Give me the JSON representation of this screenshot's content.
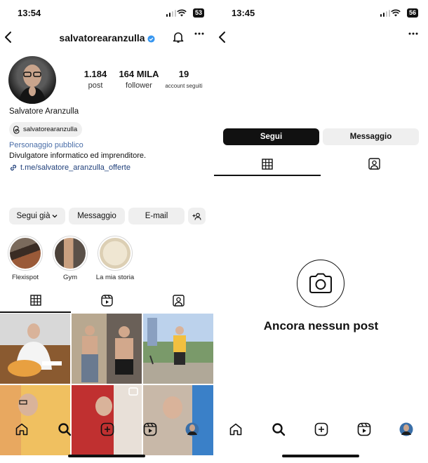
{
  "left": {
    "status": {
      "time": "13:54",
      "battery": "53"
    },
    "username": "salvatorearanzulla",
    "stats": [
      {
        "value": "1.184",
        "label": "post"
      },
      {
        "value": "164 MILA",
        "label": "follower"
      },
      {
        "value": "19",
        "label": "account seguiti"
      }
    ],
    "full_name": "Salvatore Aranzulla",
    "threads_handle": "salvatorearanzulla",
    "category": "Personaggio pubblico",
    "bio": "Divulgatore informatico ed imprenditore.",
    "link": "t.me/salvatore_aranzulla_offerte",
    "buttons": {
      "following": "Segui già",
      "message": "Messaggio",
      "email": "E-mail"
    },
    "highlights": [
      {
        "label": "Flexispot"
      },
      {
        "label": "Gym"
      },
      {
        "label": "La mia storia"
      }
    ]
  },
  "right": {
    "status": {
      "time": "13:45",
      "battery": "56"
    },
    "buttons": {
      "follow": "Segui",
      "message": "Messaggio"
    },
    "empty_text": "Ancora nessun post"
  },
  "colors": {
    "category": "#4a6ea8",
    "link": "#1f3f7a",
    "verified": "#3897f0",
    "button_bg": "#efefef",
    "follow_bg": "#111111"
  },
  "icons": [
    "chevron-left-icon",
    "verified-badge-icon",
    "bell-icon",
    "more-icon",
    "threads-icon",
    "link-icon",
    "add-person-icon",
    "grid-icon",
    "reels-icon",
    "tagged-icon",
    "home-icon",
    "search-icon",
    "create-icon",
    "camera-icon"
  ]
}
